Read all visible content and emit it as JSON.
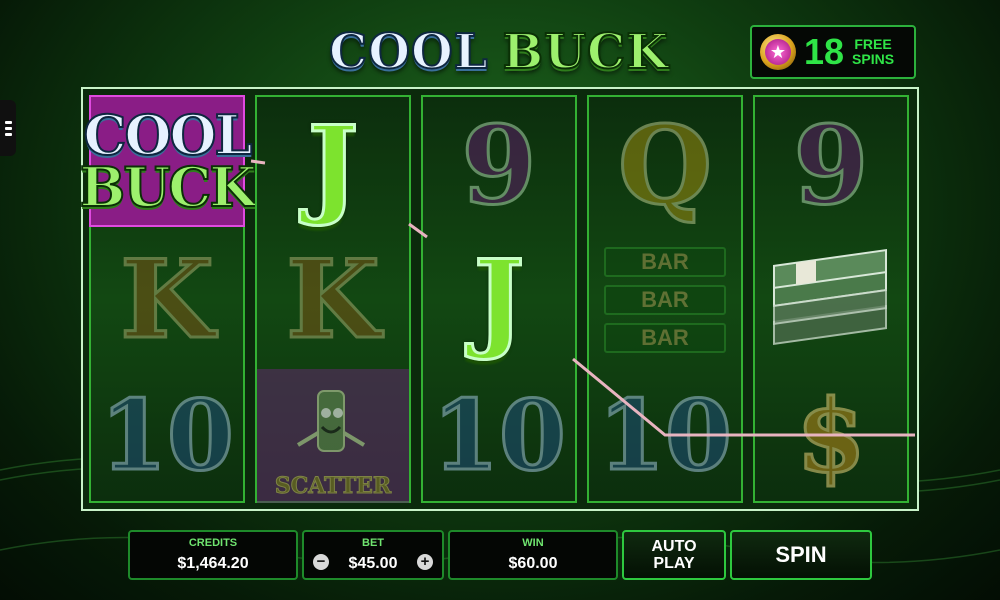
{
  "logo": {
    "word1": "COOL",
    "word2": "BUCK"
  },
  "free_spins": {
    "count": "18",
    "label_line1": "FREE",
    "label_line2": "SPINS",
    "icon": "star-coin-icon"
  },
  "menu": {
    "icon": "hamburger-menu-icon"
  },
  "reels": [
    {
      "symbols": [
        "COOL BUCK",
        "K",
        "10"
      ]
    },
    {
      "symbols": [
        "J",
        "K",
        "SCATTER"
      ]
    },
    {
      "symbols": [
        "9",
        "J",
        "10"
      ]
    },
    {
      "symbols": [
        "Q",
        "BAR",
        "10"
      ]
    },
    {
      "symbols": [
        "9",
        "cash-stack",
        "$"
      ]
    }
  ],
  "wild": {
    "line1": "COOL",
    "line2": "BUCK"
  },
  "scatter": {
    "label": "SCATTER"
  },
  "bar": {
    "label": "BAR"
  },
  "controls": {
    "credits_label": "CREDITS",
    "credits_value": "$1,464.20",
    "bet_label": "BET",
    "bet_value": "$45.00",
    "minus": "−",
    "plus": "+",
    "win_label": "WIN",
    "win_value": "$60.00",
    "auto_play_line1": "AUTO",
    "auto_play_line2": "PLAY",
    "spin_label": "SPIN"
  },
  "colors": {
    "accent_green": "#2fe447",
    "panel_border": "#1e8a2a",
    "payline": "#e8b4c0"
  }
}
